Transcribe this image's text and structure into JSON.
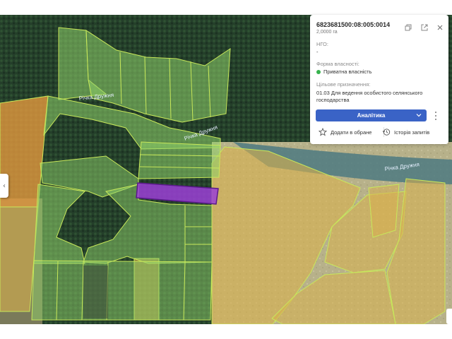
{
  "parcel": {
    "cadastral_number": "6823681500:08:005:0014",
    "area": "2,0000 га",
    "ngo_label": "НГО:",
    "ngo_value": "-",
    "ownership_label": "Форма власності:",
    "ownership_value": "Приватна власність",
    "purpose_label": "Цільове призначення:",
    "purpose_value": "01.03 Для ведення особистого селянського господарства"
  },
  "actions": {
    "analytics_label": "Аналітика",
    "add_favorites_label": "Додати в обране",
    "history_label": "Історія запитів"
  },
  "map_labels": {
    "river_1": "Річка Дружня",
    "river_2": "Річка Дружня",
    "river_3": "Річка Дружня"
  },
  "colors": {
    "selected_parcel": "#9b3fd6",
    "private_parcel": "#8fd16a",
    "state_parcel": "#d9b04c",
    "orange_parcel": "#e39a3f",
    "status_dot": "#37b24d",
    "accent_button": "#3a63c6"
  },
  "icons": {
    "copy": "copy-icon",
    "open": "open-external-icon",
    "close": "close-icon",
    "star": "star-icon",
    "history": "history-icon",
    "more": "more-vertical-icon",
    "chevron": "chevron-down-icon",
    "left_tab": "chevron-left-icon"
  }
}
